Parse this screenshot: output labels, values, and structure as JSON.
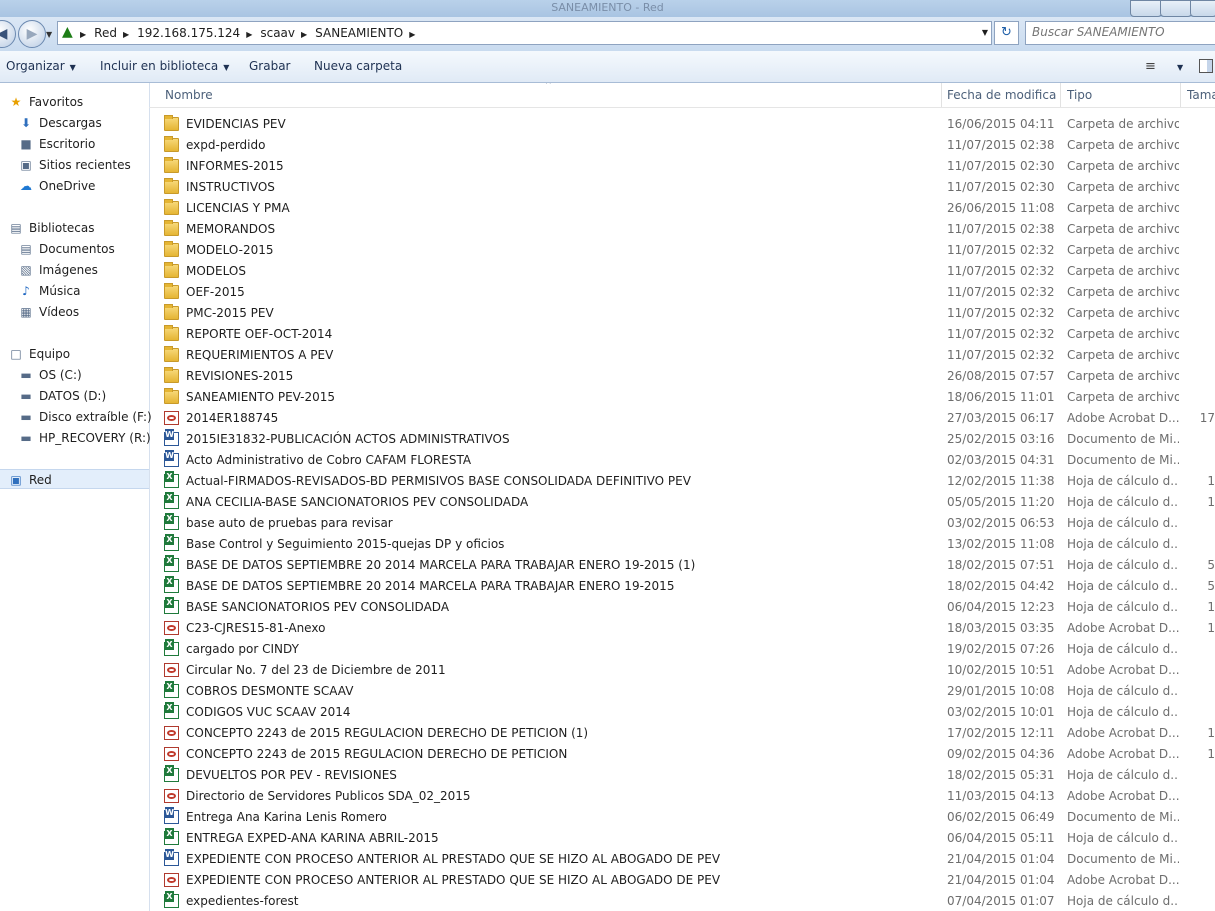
{
  "window": {
    "title": "SANEAMIENTO - Red"
  },
  "address": {
    "crumbs": [
      "Red",
      "192.168.175.124",
      "scaav",
      "SANEAMIENTO"
    ],
    "search_placeholder": "Buscar SANEAMIENTO"
  },
  "toolbar": {
    "organize": "Organizar",
    "include": "Incluir en biblioteca",
    "burn": "Grabar",
    "new_folder": "Nueva carpeta"
  },
  "nav": {
    "favorites_label": "Favoritos",
    "favorites": [
      {
        "label": "Descargas",
        "icon": "downloads-icon"
      },
      {
        "label": "Escritorio",
        "icon": "desktop-icon"
      },
      {
        "label": "Sitios recientes",
        "icon": "recent-places-icon"
      },
      {
        "label": "OneDrive",
        "icon": "cloud-icon"
      }
    ],
    "libraries_label": "Bibliotecas",
    "libraries": [
      {
        "label": "Documentos",
        "icon": "documents-icon"
      },
      {
        "label": "Imágenes",
        "icon": "pictures-icon"
      },
      {
        "label": "Música",
        "icon": "music-icon"
      },
      {
        "label": "Vídeos",
        "icon": "videos-icon"
      }
    ],
    "computer_label": "Equipo",
    "computer": [
      {
        "label": "OS (C:)",
        "icon": "drive-icon"
      },
      {
        "label": "DATOS (D:)",
        "icon": "drive-icon"
      },
      {
        "label": "Disco extraíble (F:)",
        "icon": "removable-drive-icon"
      },
      {
        "label": "HP_RECOVERY (R:)",
        "icon": "drive-icon"
      }
    ],
    "network_label": "Red"
  },
  "columns": {
    "name": "Nombre",
    "date": "Fecha de modifica...",
    "type": "Tipo",
    "size": "Tama"
  },
  "files": [
    {
      "name": "EVIDENCIAS PEV",
      "date": "16/06/2015 04:11 ...",
      "type": "Carpeta de archivos",
      "size": "",
      "icon": "folder"
    },
    {
      "name": "expd-perdido",
      "date": "11/07/2015 02:38 ...",
      "type": "Carpeta de archivos",
      "size": "",
      "icon": "folder"
    },
    {
      "name": "INFORMES-2015",
      "date": "11/07/2015 02:30 ...",
      "type": "Carpeta de archivos",
      "size": "",
      "icon": "folder"
    },
    {
      "name": "INSTRUCTIVOS",
      "date": "11/07/2015 02:30 ...",
      "type": "Carpeta de archivos",
      "size": "",
      "icon": "folder"
    },
    {
      "name": "LICENCIAS Y PMA",
      "date": "26/06/2015 11:08 a...",
      "type": "Carpeta de archivos",
      "size": "",
      "icon": "folder"
    },
    {
      "name": "MEMORANDOS",
      "date": "11/07/2015 02:38 ...",
      "type": "Carpeta de archivos",
      "size": "",
      "icon": "folder"
    },
    {
      "name": "MODELO-2015",
      "date": "11/07/2015 02:32 ...",
      "type": "Carpeta de archivos",
      "size": "",
      "icon": "folder"
    },
    {
      "name": "MODELOS",
      "date": "11/07/2015 02:32 ...",
      "type": "Carpeta de archivos",
      "size": "",
      "icon": "folder"
    },
    {
      "name": "OEF-2015",
      "date": "11/07/2015 02:32 ...",
      "type": "Carpeta de archivos",
      "size": "",
      "icon": "folder"
    },
    {
      "name": "PMC-2015 PEV",
      "date": "11/07/2015 02:32 ...",
      "type": "Carpeta de archivos",
      "size": "",
      "icon": "folder"
    },
    {
      "name": "REPORTE OEF-OCT-2014",
      "date": "11/07/2015 02:32 ...",
      "type": "Carpeta de archivos",
      "size": "",
      "icon": "folder"
    },
    {
      "name": "REQUERIMIENTOS A PEV",
      "date": "11/07/2015 02:32 ...",
      "type": "Carpeta de archivos",
      "size": "",
      "icon": "folder"
    },
    {
      "name": "REVISIONES-2015",
      "date": "26/08/2015 07:57 ...",
      "type": "Carpeta de archivos",
      "size": "",
      "icon": "folder"
    },
    {
      "name": "SANEAMIENTO PEV-2015",
      "date": "18/06/2015 11:01 a...",
      "type": "Carpeta de archivos",
      "size": "",
      "icon": "folder"
    },
    {
      "name": "2014ER188745",
      "date": "27/03/2015 06:17 ...",
      "type": "Adobe Acrobat D...",
      "size": "17",
      "icon": "pdf"
    },
    {
      "name": "2015IE31832-PUBLICACIÓN ACTOS ADMINISTRATIVOS",
      "date": "25/02/2015 03:16 ...",
      "type": "Documento de Mi...",
      "size": "",
      "icon": "word"
    },
    {
      "name": "Acto Administrativo de Cobro CAFAM FLORESTA",
      "date": "02/03/2015 04:31 ...",
      "type": "Documento de Mi...",
      "size": "",
      "icon": "word"
    },
    {
      "name": "Actual-FIRMADOS-REVISADOS-BD PERMISIVOS BASE CONSOLIDADA DEFINITIVO PEV",
      "date": "12/02/2015 11:38 a...",
      "type": "Hoja de cálculo d...",
      "size": "1",
      "icon": "excel"
    },
    {
      "name": "ANA CECILIA-BASE SANCIONATORIOS PEV CONSOLIDADA",
      "date": "05/05/2015 11:20 a...",
      "type": "Hoja de cálculo d...",
      "size": "1",
      "icon": "excel"
    },
    {
      "name": "base auto de pruebas para revisar",
      "date": "03/02/2015 06:53 ...",
      "type": "Hoja de cálculo d...",
      "size": "",
      "icon": "excel"
    },
    {
      "name": "Base Control y Seguimiento 2015-quejas DP y oficios",
      "date": "13/02/2015 11:08 a...",
      "type": "Hoja de cálculo d...",
      "size": "",
      "icon": "excel"
    },
    {
      "name": "BASE DE DATOS SEPTIEMBRE 20 2014 MARCELA PARA TRABAJAR ENERO 19-2015 (1)",
      "date": "18/02/2015 07:51 ...",
      "type": "Hoja de cálculo d...",
      "size": "5",
      "icon": "excel"
    },
    {
      "name": "BASE DE DATOS SEPTIEMBRE 20 2014 MARCELA PARA TRABAJAR ENERO 19-2015",
      "date": "18/02/2015 04:42 ...",
      "type": "Hoja de cálculo d...",
      "size": "5",
      "icon": "excel"
    },
    {
      "name": "BASE SANCIONATORIOS PEV CONSOLIDADA",
      "date": "06/04/2015 12:23 ...",
      "type": "Hoja de cálculo d...",
      "size": "1",
      "icon": "excel"
    },
    {
      "name": "C23-CJRES15-81-Anexo",
      "date": "18/03/2015 03:35 ...",
      "type": "Adobe Acrobat D...",
      "size": "1",
      "icon": "pdf"
    },
    {
      "name": "cargado por CINDY",
      "date": "19/02/2015 07:26 ...",
      "type": "Hoja de cálculo d...",
      "size": "",
      "icon": "excel"
    },
    {
      "name": "Circular No. 7 del 23 de Diciembre de 2011",
      "date": "10/02/2015 10:51 a...",
      "type": "Adobe Acrobat D...",
      "size": "",
      "icon": "pdf"
    },
    {
      "name": "COBROS DESMONTE SCAAV",
      "date": "29/01/2015 10:08 a...",
      "type": "Hoja de cálculo d...",
      "size": "",
      "icon": "excel"
    },
    {
      "name": "CODIGOS VUC SCAAV 2014",
      "date": "03/02/2015 10:01 a...",
      "type": "Hoja de cálculo d...",
      "size": "",
      "icon": "excel"
    },
    {
      "name": "CONCEPTO 2243 de 2015 REGULACION DERECHO DE PETICION (1)",
      "date": "17/02/2015 12:11 ...",
      "type": "Adobe Acrobat D...",
      "size": "1",
      "icon": "pdf"
    },
    {
      "name": "CONCEPTO 2243 de 2015 REGULACION DERECHO DE PETICION",
      "date": "09/02/2015 04:36 ...",
      "type": "Adobe Acrobat D...",
      "size": "1",
      "icon": "pdf"
    },
    {
      "name": "DEVUELTOS POR PEV - REVISIONES",
      "date": "18/02/2015 05:31 ...",
      "type": "Hoja de cálculo d...",
      "size": "",
      "icon": "excel"
    },
    {
      "name": "Directorio de Servidores Publicos SDA_02_2015",
      "date": "11/03/2015 04:13 ...",
      "type": "Adobe Acrobat D...",
      "size": "",
      "icon": "pdf"
    },
    {
      "name": "Entrega Ana Karina Lenis Romero",
      "date": "06/02/2015 06:49 ...",
      "type": "Documento de Mi...",
      "size": "",
      "icon": "word"
    },
    {
      "name": "ENTREGA EXPED-ANA KARINA ABRIL-2015",
      "date": "06/04/2015 05:11 ...",
      "type": "Hoja de cálculo d...",
      "size": "",
      "icon": "excel"
    },
    {
      "name": "EXPEDIENTE CON PROCESO ANTERIOR AL PRESTADO QUE SE HIZO AL ABOGADO DE PEV",
      "date": "21/04/2015 01:04 ...",
      "type": "Documento de Mi...",
      "size": "",
      "icon": "word"
    },
    {
      "name": "EXPEDIENTE CON PROCESO ANTERIOR AL PRESTADO QUE SE HIZO AL ABOGADO DE PEV",
      "date": "21/04/2015 01:04 ...",
      "type": "Adobe Acrobat D...",
      "size": "",
      "icon": "pdf"
    },
    {
      "name": "expedientes-forest",
      "date": "07/04/2015 01:07 ...",
      "type": "Hoja de cálculo d...",
      "size": "",
      "icon": "excel"
    }
  ]
}
